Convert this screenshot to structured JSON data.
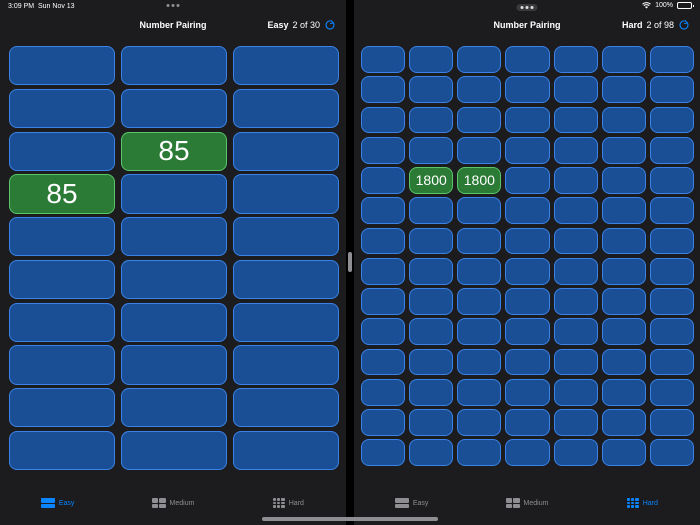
{
  "status": {
    "time": "3:09 PM",
    "date": "Sun Nov 13",
    "battery": "100%"
  },
  "left": {
    "title": "Number Pairing",
    "level": "Easy",
    "progress": "2 of 30",
    "cols": 3,
    "rows": 10,
    "revealed": [
      {
        "index": 7,
        "value": "85"
      },
      {
        "index": 9,
        "value": "85"
      }
    ],
    "tabs": [
      {
        "label": "Easy",
        "icon": "easy-layout-icon",
        "active": true
      },
      {
        "label": "Medium",
        "icon": "medium-layout-icon",
        "active": false
      },
      {
        "label": "Hard",
        "icon": "hard-layout-icon",
        "active": false
      }
    ]
  },
  "right": {
    "title": "Number Pairing",
    "level": "Hard",
    "progress": "2 of 98",
    "cols": 7,
    "rows": 14,
    "revealed": [
      {
        "index": 29,
        "value": "1800"
      },
      {
        "index": 30,
        "value": "1800"
      }
    ],
    "tabs": [
      {
        "label": "Easy",
        "icon": "easy-layout-icon",
        "active": false
      },
      {
        "label": "Medium",
        "icon": "medium-layout-icon",
        "active": false
      },
      {
        "label": "Hard",
        "icon": "hard-layout-icon",
        "active": true
      }
    ]
  },
  "colors": {
    "tile": "#1a4f95",
    "tile_border": "#3a82e8",
    "matched": "#2b7a36",
    "matched_border": "#59c66a",
    "accent": "#0a84ff"
  }
}
